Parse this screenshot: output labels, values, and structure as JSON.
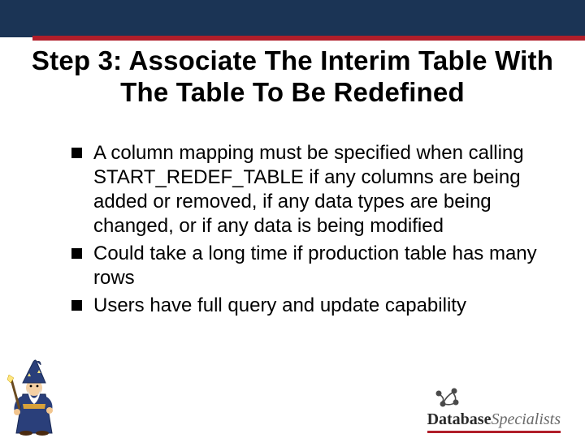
{
  "title": "Step 3: Associate The Interim Table With The Table To Be Redefined",
  "bullets": [
    "A column mapping must be specified when calling START_REDEF_TABLE if any columns are being added or removed, if any data types are being changed, or if any data is being modified",
    "Could take a long time if production table has many rows",
    "Users have full query and update capability"
  ],
  "footer": {
    "company_bold": "Database",
    "company_light": "Specialists"
  }
}
